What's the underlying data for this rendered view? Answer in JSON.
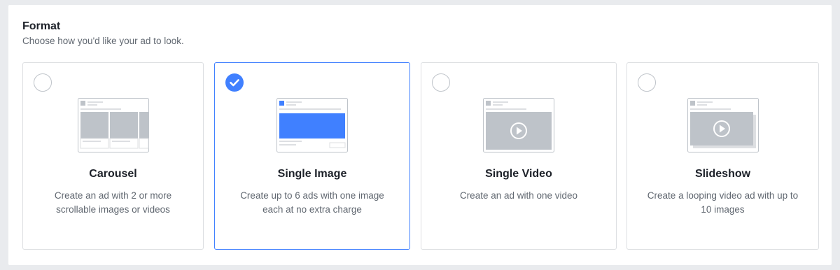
{
  "section": {
    "title": "Format",
    "subtitle": "Choose how you'd like your ad to look."
  },
  "cards": [
    {
      "title": "Carousel",
      "description": "Create an ad with 2 or more scrollable images or videos",
      "selected": false,
      "icon": "carousel-icon"
    },
    {
      "title": "Single Image",
      "description": "Create up to 6 ads with one image each at no extra charge",
      "selected": true,
      "icon": "single-image-icon"
    },
    {
      "title": "Single Video",
      "description": "Create an ad with one video",
      "selected": false,
      "icon": "single-video-icon"
    },
    {
      "title": "Slideshow",
      "description": "Create a looping video ad with up to 10 images",
      "selected": false,
      "icon": "slideshow-icon"
    }
  ],
  "colors": {
    "accent": "#4080ff",
    "placeholder_gray": "#bec3c9",
    "border": "#dddfe2",
    "text_primary": "#1d2129",
    "text_secondary": "#606770"
  }
}
